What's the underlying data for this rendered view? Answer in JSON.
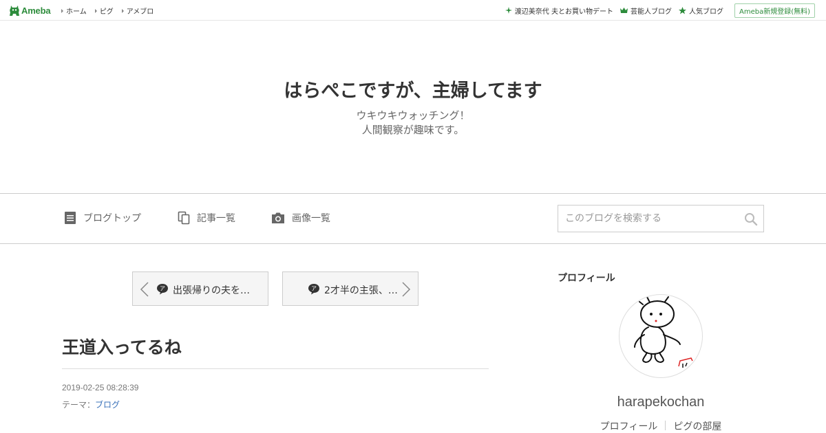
{
  "topbar": {
    "logo_text": "Ameba",
    "nav": [
      "ホーム",
      "ピグ",
      "アメブロ"
    ],
    "right_links": [
      {
        "label": "渡辺美奈代 夫とお買い物デート",
        "icon": "sparkle-icon"
      },
      {
        "label": "芸能人ブログ",
        "icon": "crown-icon"
      },
      {
        "label": "人気ブログ",
        "icon": "star-icon"
      }
    ],
    "register_label": "Ameba新規登録(無料)"
  },
  "header": {
    "title": "はらぺこですが、主婦してます",
    "desc_line1": "ウキウキウォッチング！",
    "desc_line2": "人間観察が趣味です。"
  },
  "nav": {
    "blog_top": "ブログトップ",
    "entry_list": "記事一覧",
    "image_list": "画像一覧",
    "search_placeholder": "このブログを検索する"
  },
  "pager": {
    "prev_label": "出張帰りの夫を…",
    "next_label": "2才半の主張、…"
  },
  "entry": {
    "title": "王道入ってるね",
    "date": "2019-02-25 08:28:39",
    "theme_prefix": "テーマ：",
    "theme_link": "ブログ"
  },
  "sidebar": {
    "heading": "プロフィール",
    "name": "harapekochan",
    "links": [
      "プロフィール",
      "ピグの部屋"
    ]
  },
  "colors": {
    "brand_green": "#2d8c3c",
    "link_blue": "#3870b8"
  }
}
